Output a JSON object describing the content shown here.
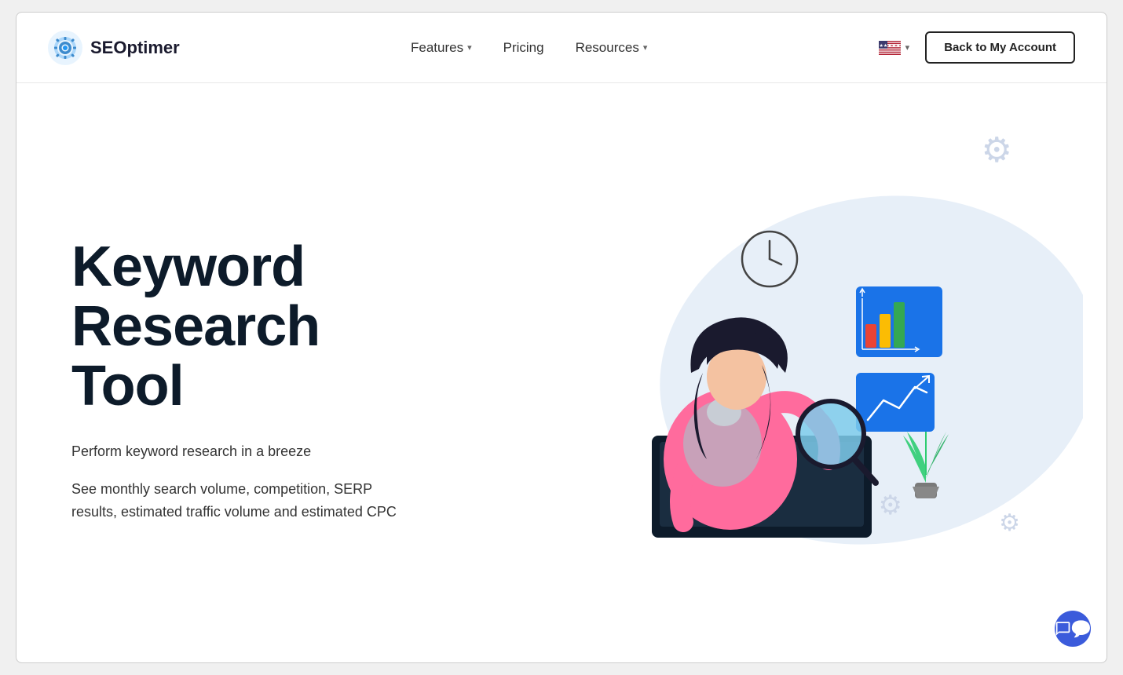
{
  "brand": {
    "logo_text": "SEOptimer",
    "logo_icon_alt": "SEOptimer gear logo"
  },
  "nav": {
    "links": [
      {
        "label": "Features",
        "has_dropdown": true
      },
      {
        "label": "Pricing",
        "has_dropdown": false
      },
      {
        "label": "Resources",
        "has_dropdown": true
      }
    ],
    "back_button_label": "Back to My Account",
    "language_selector": "en-US"
  },
  "hero": {
    "title_line1": "Keyword",
    "title_line2": "Research",
    "title_line3": "Tool",
    "title_underline_word": "Research",
    "subtitle": "Perform keyword research in a breeze",
    "description": "See monthly search volume, competition, SERP results, estimated traffic volume and estimated CPC"
  },
  "chat": {
    "icon_label": "chat-support-icon"
  }
}
